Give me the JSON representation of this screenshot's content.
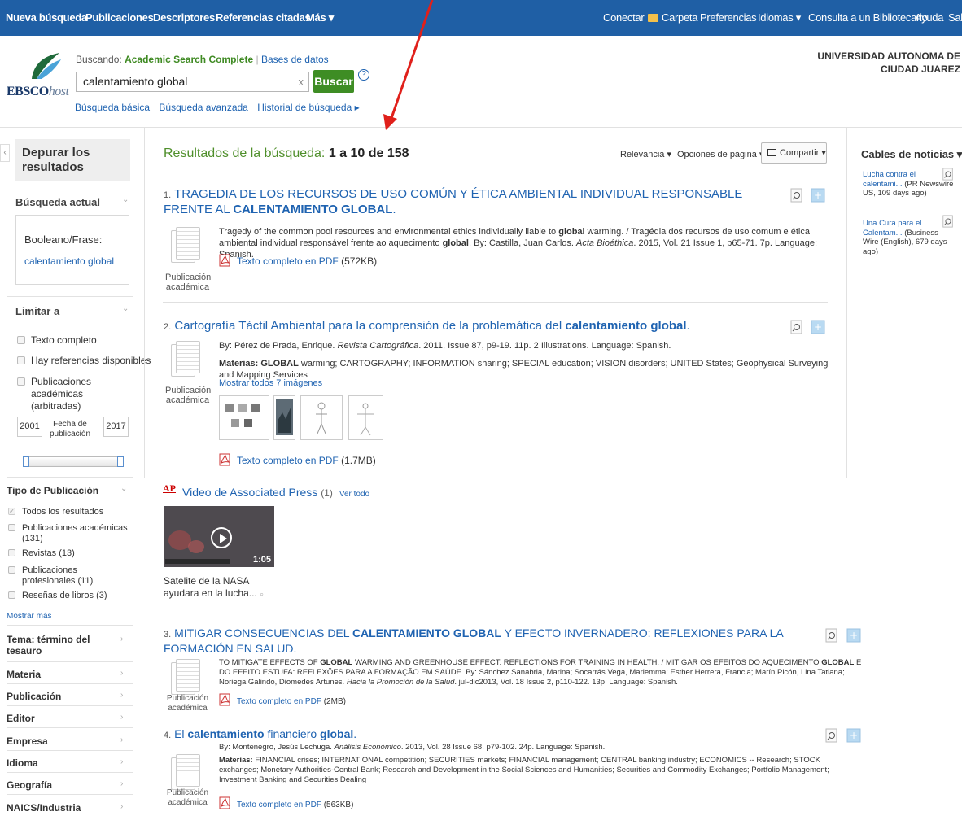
{
  "topnav": {
    "left": [
      "Nueva búsqueda",
      "Publicaciones",
      "Descriptores",
      "Referencias citadas",
      "Más ▾"
    ],
    "right": [
      "Conectar",
      "Carpeta",
      "Preferencias",
      "Idiomas ▾",
      "Consulta a un Bibliotecario",
      "Ayuda",
      "Sali"
    ]
  },
  "brand": {
    "ebsco": "EBSCO",
    "host": "host"
  },
  "search": {
    "buscando_label": "Buscando:",
    "database": "Academic Search Complete",
    "bases": "Bases de datos",
    "query": "calentamiento global",
    "clear": "x",
    "button": "Buscar",
    "help": "?",
    "links": [
      "Búsqueda básica",
      "Búsqueda avanzada",
      "Historial de búsqueda ▸"
    ]
  },
  "institution": "UNIVERSIDAD AUTONOMA DE\nCIUDAD JUAREZ",
  "sidebar": {
    "collapse": "‹",
    "refine": "Depurar los resultados",
    "current": "Búsqueda actual",
    "boolean_label": "Booleano/Frase:",
    "boolean_value": "calentamiento global",
    "limit": "Limitar a",
    "limits": [
      "Texto completo",
      "Hay referencias disponibles",
      "Publicaciones académicas (arbitradas)"
    ],
    "year_from": "2001",
    "year_label": "Fecha de publicación",
    "year_to": "2017",
    "pubtype_title": "Tipo de Publicación",
    "pubtypes": [
      {
        "label": "Todos los resultados",
        "count": ""
      },
      {
        "label": "Publicaciones académicas",
        "count": "(131)"
      },
      {
        "label": "Revistas",
        "count": "(13)"
      },
      {
        "label": "Publicaciones profesionales",
        "count": "(11)"
      },
      {
        "label": "Reseñas de libros",
        "count": "(3)"
      }
    ],
    "more": "Mostrar más",
    "facets": [
      "Tema: término del tesauro",
      "Materia",
      "Publicación",
      "Editor",
      "Empresa",
      "Idioma",
      "Geografía",
      "NAICS/Industria"
    ]
  },
  "results": {
    "heading": "Resultados de la búsqueda:",
    "range": "1 a 10 de 158",
    "sort": "Relevancia ▾",
    "page_options": "Opciones de página ▾",
    "share": "Compartir ▾",
    "doc_label": "Publicación académica",
    "items": [
      {
        "n": "1.",
        "t1": "TRAGEDIA DE LOS RECURSOS DE USO COMÚN Y ÉTICA AMBIENTAL INDIVIDUAL RESPONSABLE FRENTE AL",
        "t2": "CALENTAMIENTO GLOBAL",
        "t3": ".",
        "d1": "Tragedy of the common pool resources and environmental ethics individually liable to ",
        "d1b": "global",
        "d1c": " warming. / Tragédia dos recursos de uso comum e ética ambiental individual responsável frente ao aquecimento ",
        "d1d": "global",
        "d1e": ". By: Castilla, Juan Carlos. ",
        "d1j": "Acta Bioéthica",
        "d1f": ". 2015, Vol. 21 Issue 1, p65-71. 7p. Language: Spanish.",
        "pdf": "Texto completo en PDF",
        "size": "(572KB)"
      },
      {
        "n": "2.",
        "t1": "Cartografía Táctil Ambiental para la comprensión de la problemática del ",
        "t2": "calentamiento global",
        "t3": ".",
        "by": "By: Pérez de Prada, Enrique. ",
        "journal": "Revista Cartográfica",
        "byrest": ". 2011, Issue 87, p9-19. 11p. 2 Illustrations. Language: Spanish.",
        "subj_label": "Materias: ",
        "subj_b": "GLOBAL",
        "subj": " warming; CARTOGRAPHY; INFORMATION sharing; SPECIAL education; VISION disorders; UNITED States; Geophysical Surveying and Mapping Services",
        "images": "Mostrar todos 7 imágenes",
        "pdf": "Texto completo en PDF",
        "size": "(1.7MB)"
      },
      {
        "n": "3.",
        "t1": "MITIGAR CONSECUENCIAS DEL ",
        "t2": "CALENTAMIENTO GLOBAL",
        "t3": " Y EFECTO INVERNADERO: REFLEXIONES PARA LA FORMACIÓN EN SALUD.",
        "d1": "TO MITIGATE EFFECTS OF ",
        "d1b": "GLOBAL",
        "d1c": " WARMING AND GREENHOUSE EFFECT: REFLECTIONS FOR TRAINING IN HEALTH. / MITIGAR OS EFEITOS DO AQUECIMENTO ",
        "d1d": "GLOBAL",
        "d1e": " E DO EFEITO ESTUFA: REFLEXÕES PARA A FORMAÇÃO EM SAÚDE. By: Sánchez Sanabria, Marina; Socarrás Vega, Mariemma; Esther Herrera, Francia; Marín Picón, Lina Tatiana; Noriega Galindo, Diomedes Artunes. ",
        "d1j": "Hacia la Promoción de la Salud",
        "d1f": ". jul-dic2013, Vol. 18 Issue 2, p110-122. 13p. Language: Spanish.",
        "pdf": "Texto completo en PDF",
        "size": "(2MB)"
      },
      {
        "n": "4.",
        "t1": "El ",
        "t2": "calentamiento",
        "t3": " financiero ",
        "t4": "global",
        "t5": ".",
        "by": "By: Montenegro, Jesús Lechuga. ",
        "journal": "Análisis Económico",
        "byrest": ". 2013, Vol. 28 Issue 68, p79-102. 24p. Language: Spanish.",
        "subj_label": "Materias: ",
        "subj": "FINANCIAL crises; INTERNATIONAL competition; SECURITIES markets; FINANCIAL management; CENTRAL banking industry; ECONOMICS -- Research; STOCK exchanges; Monetary Authorities-Central Bank; Research and Development in the Social Sciences and Humanities; Securities and Commodity Exchanges; Portfolio Management; Investment Banking and Securities Dealing",
        "pdf": "Texto completo en PDF",
        "size": "(563KB)"
      }
    ]
  },
  "ap": {
    "logo": "AP",
    "title": "Video de Associated Press",
    "count": "(1)",
    "see_all": "Ver todo",
    "duration": "1:05",
    "caption": "Satelite de la NASA ayudara en la lucha..."
  },
  "news": {
    "title": "Cables de noticias ▾",
    "items": [
      {
        "link": "Lucha contra el calentami...",
        "src": " (PR Newswire US, 109 days ago)"
      },
      {
        "link": "Una Cura para el Calentam...",
        "src": " (Business Wire (English), 679 days ago)"
      }
    ]
  },
  "colors": {
    "topbar": "#1f5fa5",
    "link": "#1f63b1",
    "green": "#3e8d24",
    "annotation_arrow": "#e0201b"
  }
}
